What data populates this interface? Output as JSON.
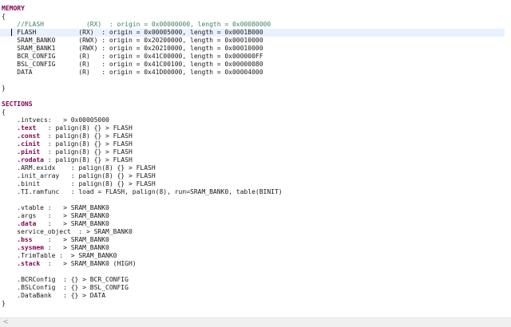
{
  "lines": [
    {
      "parts": [
        {
          "text": "MEMORY",
          "style": "kw"
        }
      ]
    },
    {
      "parts": [
        {
          "text": "{"
        }
      ]
    },
    {
      "parts": [
        {
          "text": "    //FLASH           (RX)  : origin = 0x00000000, length = 0x00080000",
          "style": "cmt"
        }
      ]
    },
    {
      "current": true,
      "parts": [
        {
          "text": "    FLASH           (RX)  : origin = 0x00005000, length = 0x0001B000"
        }
      ]
    },
    {
      "parts": [
        {
          "text": "    SRAM_BANK0      (RWX) : origin = 0x20200000, length = 0x00010000"
        }
      ]
    },
    {
      "parts": [
        {
          "text": "    SRAM_BANK1      (RWX) : origin = 0x20210000, length = 0x00010000"
        }
      ]
    },
    {
      "parts": [
        {
          "text": "    BCR_CONFIG      (R)   : origin = 0x41C00000, length = 0x000000FF"
        }
      ]
    },
    {
      "parts": [
        {
          "text": "    BSL_CONFIG      (R)   : origin = 0x41C00100, length = 0x00000080"
        }
      ]
    },
    {
      "parts": [
        {
          "text": "    DATA            (R)   : origin = 0x41D00000, length = 0x00004000"
        }
      ]
    },
    {
      "parts": [
        {
          "text": ""
        }
      ]
    },
    {
      "parts": [
        {
          "text": "}"
        }
      ]
    },
    {
      "parts": [
        {
          "text": ""
        }
      ]
    },
    {
      "parts": [
        {
          "text": "SECTIONS",
          "style": "kw"
        }
      ]
    },
    {
      "parts": [
        {
          "text": "{"
        }
      ]
    },
    {
      "parts": [
        {
          "text": "    .intvecs:   > 0x00005000"
        }
      ]
    },
    {
      "parts": [
        {
          "text": "    "
        },
        {
          "text": ".text",
          "style": "kw"
        },
        {
          "text": "   : palign(8) {} > FLASH"
        }
      ]
    },
    {
      "parts": [
        {
          "text": "    "
        },
        {
          "text": ".const",
          "style": "kw"
        },
        {
          "text": "  : palign(8) {} > FLASH"
        }
      ]
    },
    {
      "parts": [
        {
          "text": "    "
        },
        {
          "text": ".cinit",
          "style": "kw"
        },
        {
          "text": "  : palign(8) {} > FLASH"
        }
      ]
    },
    {
      "parts": [
        {
          "text": "    "
        },
        {
          "text": ".pinit",
          "style": "kw"
        },
        {
          "text": "  : palign(8) {} > FLASH"
        }
      ]
    },
    {
      "parts": [
        {
          "text": "    "
        },
        {
          "text": ".rodata",
          "style": "kw"
        },
        {
          "text": " : palign(8) {} > FLASH"
        }
      ]
    },
    {
      "parts": [
        {
          "text": "    .ARM.exidx    : palign(8) {} > FLASH"
        }
      ]
    },
    {
      "parts": [
        {
          "text": "    .init_array   : palign(8) {} > FLASH"
        }
      ]
    },
    {
      "parts": [
        {
          "text": "    .binit        : palign(8) {} > FLASH"
        }
      ]
    },
    {
      "parts": [
        {
          "text": "    .TI.ramfunc   : load = FLASH, palign(8), run=SRAM_BANK0, table(BINIT)"
        }
      ]
    },
    {
      "parts": [
        {
          "text": ""
        }
      ]
    },
    {
      "parts": [
        {
          "text": "    .vtable :   > SRAM_BANK0"
        }
      ]
    },
    {
      "parts": [
        {
          "text": "    .args   :   > SRAM_BANK0"
        }
      ]
    },
    {
      "parts": [
        {
          "text": "    "
        },
        {
          "text": ".data",
          "style": "kw"
        },
        {
          "text": "   :   > SRAM_BANK0"
        }
      ]
    },
    {
      "parts": [
        {
          "text": "    service_object  : > SRAM_BANK0"
        }
      ]
    },
    {
      "parts": [
        {
          "text": "    "
        },
        {
          "text": ".bss",
          "style": "kw"
        },
        {
          "text": "    :   > SRAM_BANK0"
        }
      ]
    },
    {
      "parts": [
        {
          "text": "    "
        },
        {
          "text": ".sysmem",
          "style": "kw"
        },
        {
          "text": " :   > SRAM_BANK0"
        }
      ]
    },
    {
      "parts": [
        {
          "text": "    .TrimTable :  > SRAM_BANK0"
        }
      ]
    },
    {
      "parts": [
        {
          "text": "    "
        },
        {
          "text": ".stack",
          "style": "kw"
        },
        {
          "text": "  :   > SRAM_BANK0 (HIGH)"
        }
      ]
    },
    {
      "parts": [
        {
          "text": ""
        }
      ]
    },
    {
      "parts": [
        {
          "text": "    .BCRConfig  : {} > BCR_CONFIG"
        }
      ]
    },
    {
      "parts": [
        {
          "text": "    .BSLConfig  : {} > BSL_CONFIG"
        }
      ]
    },
    {
      "parts": [
        {
          "text": "    .DataBank   : {} > DATA"
        }
      ]
    },
    {
      "parts": [
        {
          "text": "}"
        }
      ]
    }
  ],
  "scrollbar": {
    "left_arrow": "<"
  }
}
